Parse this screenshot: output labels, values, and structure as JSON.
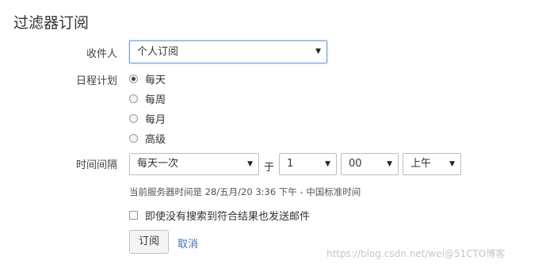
{
  "title": "过滤器订阅",
  "recipient": {
    "label": "收件人",
    "value": "个人订阅"
  },
  "schedule": {
    "label": "日程计划",
    "options": [
      {
        "label": "每天",
        "checked": true
      },
      {
        "label": "每周",
        "checked": false
      },
      {
        "label": "每月",
        "checked": false
      },
      {
        "label": "高级",
        "checked": false
      }
    ]
  },
  "interval": {
    "label": "时间间隔",
    "frequency": "每天一次",
    "at": "于",
    "hour": "1",
    "minute": "00",
    "ampm": "上午"
  },
  "server_time": "当前服务器时间是 28/五月/20 3:36 下午 - 中国标准时间",
  "send_empty": {
    "label": "即使没有搜索到符合结果也发送邮件",
    "checked": false
  },
  "buttons": {
    "subscribe": "订阅",
    "cancel": "取消"
  },
  "watermark": "https://blog.csdn.net/wei@51CTO博客"
}
